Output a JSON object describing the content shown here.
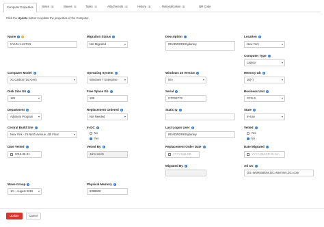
{
  "tabs": [
    {
      "label": "Computer Properties",
      "count": null
    },
    {
      "label": "Notes",
      "count": "1"
    },
    {
      "label": "Waves",
      "count": "1"
    },
    {
      "label": "Tasks",
      "count": "1"
    },
    {
      "label": "Attachments",
      "count": "1"
    },
    {
      "label": "History",
      "count": "1"
    },
    {
      "label": "Rationalization",
      "count": "1"
    },
    {
      "label": "QR Code",
      "count": null
    }
  ],
  "instructions": {
    "before": "Click the ",
    "bold": "Update",
    "after": " button to update the properties of the Computer."
  },
  "fields": {
    "name": {
      "label": "Name",
      "value": "NYUN-1-LSTAN"
    },
    "migration_status": {
      "label": "Migration Status",
      "value": "Not Migrated"
    },
    "description": {
      "label": "Description",
      "value": "READWORKS\\jdanley"
    },
    "location": {
      "label": "Location",
      "value": "New York"
    },
    "computer_type": {
      "label": "Computer Type",
      "value": "Laptop"
    },
    "computer_model": {
      "label": "Computer Model",
      "value": "X1 Carbon (1st Gen)"
    },
    "operating_system": {
      "label": "Operating System",
      "value": "Windows 7 Enterprise"
    },
    "win10_version": {
      "label": "Windows 10 Version",
      "value": "N/A"
    },
    "memory_gb": {
      "label": "Memory Gb",
      "value": "16(+)"
    },
    "disk_size_gb": {
      "label": "Disk Size Gb",
      "value": "128"
    },
    "free_space_gb": {
      "label": "Free Space Gb",
      "value": "108"
    },
    "serial": {
      "label": "Serial",
      "value": "C7P0DT73"
    },
    "business_unit": {
      "label": "Business Unit",
      "value": "CFO-S"
    },
    "department": {
      "label": "Department",
      "value": "Advisory Program"
    },
    "replacement_ordered": {
      "label": "Replacement Ordered",
      "value": "Not Needed"
    },
    "static_ip": {
      "label": "Static Ip",
      "value": ""
    },
    "state": {
      "label": "State",
      "value": "In-Use"
    },
    "central_build_site": {
      "label": "Central Build Site",
      "value": "New York - 76 Ninth Avenue, 4th Floor"
    },
    "in_dc": {
      "label": "In DC",
      "options": [
        "No",
        "Yes"
      ],
      "selected": "Yes"
    },
    "last_logon_user": {
      "label": "Last Logon User",
      "value": "READWORKS\\jdanley"
    },
    "vetted": {
      "label": "Vetted",
      "options": [
        "Yes",
        "No"
      ],
      "selected": "No"
    },
    "date_vetted": {
      "label": "Date Vetted",
      "value": "2019-05-31"
    },
    "vetted_by": {
      "label": "Vetted By",
      "value": "John Smith"
    },
    "replacement_order_date": {
      "label": "Replacement Order Date",
      "placeholder": "YYYY-MM-DD"
    },
    "date_migrated": {
      "label": "Date Migrated",
      "placeholder": "YYYY-MM-DD hh:mm"
    },
    "migrated_by": {
      "label": "Migrated By",
      "value": ""
    },
    "ad_ou": {
      "label": "Ad Ou",
      "value": "OU=Workstations,DC=stemmm,DC=com"
    },
    "wave_group": {
      "label": "Wave Group",
      "value": "10 -- August 2019"
    },
    "physical_memory": {
      "label": "Physical Memory",
      "value": "8388608"
    }
  },
  "buttons": {
    "update": "Update",
    "cancel": "Cancel"
  },
  "colors": {
    "accent": "#3b7fd0",
    "danger": "#d9332b",
    "warn": "#e6b03a"
  }
}
